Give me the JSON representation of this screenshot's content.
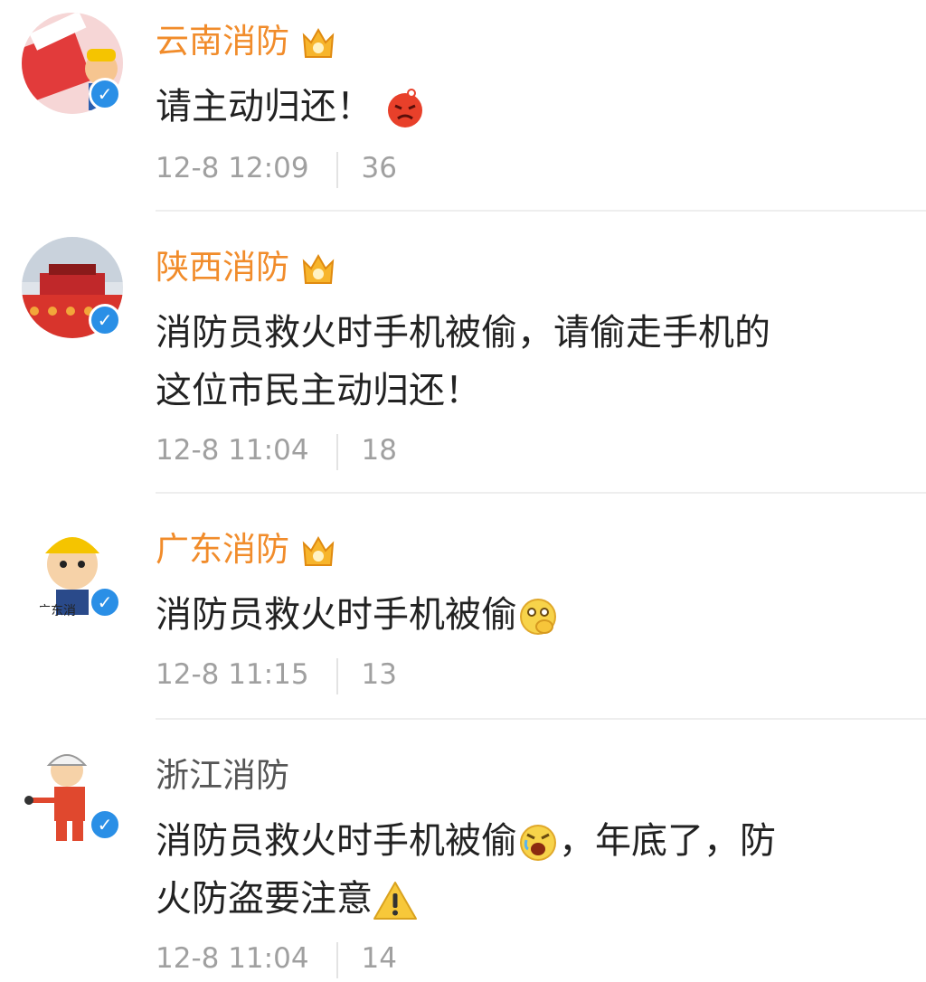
{
  "comments": [
    {
      "username": "云南消防",
      "text": "请主动归还！",
      "time": "12-8 12:09",
      "likes": "36",
      "emoji": "angry-red-face-icon",
      "name_color": "#f18c2b"
    },
    {
      "username": "陕西消防",
      "text_line1": "消防员救火时手机被偷，请偷走手机的",
      "text_line2": "这位市民主动归还！",
      "time": "12-8 11:04",
      "likes": "18",
      "name_color": "#f18c2b"
    },
    {
      "username": "广东消防",
      "text": "消防员救火时手机被偷",
      "time": "12-8 11:15",
      "likes": "13",
      "emoji": "thinking-face-icon",
      "name_color": "#f18c2b"
    },
    {
      "username": "浙江消防",
      "text_line1a": "消防员救火时手机被偷",
      "text_line1b": "，年底了，防",
      "text_line2": "火防盗要注意",
      "time": "12-8 11:04",
      "likes": "14",
      "emoji1": "crying-shouting-face-icon",
      "emoji2": "warning-icon",
      "name_color": "#555555"
    }
  ]
}
